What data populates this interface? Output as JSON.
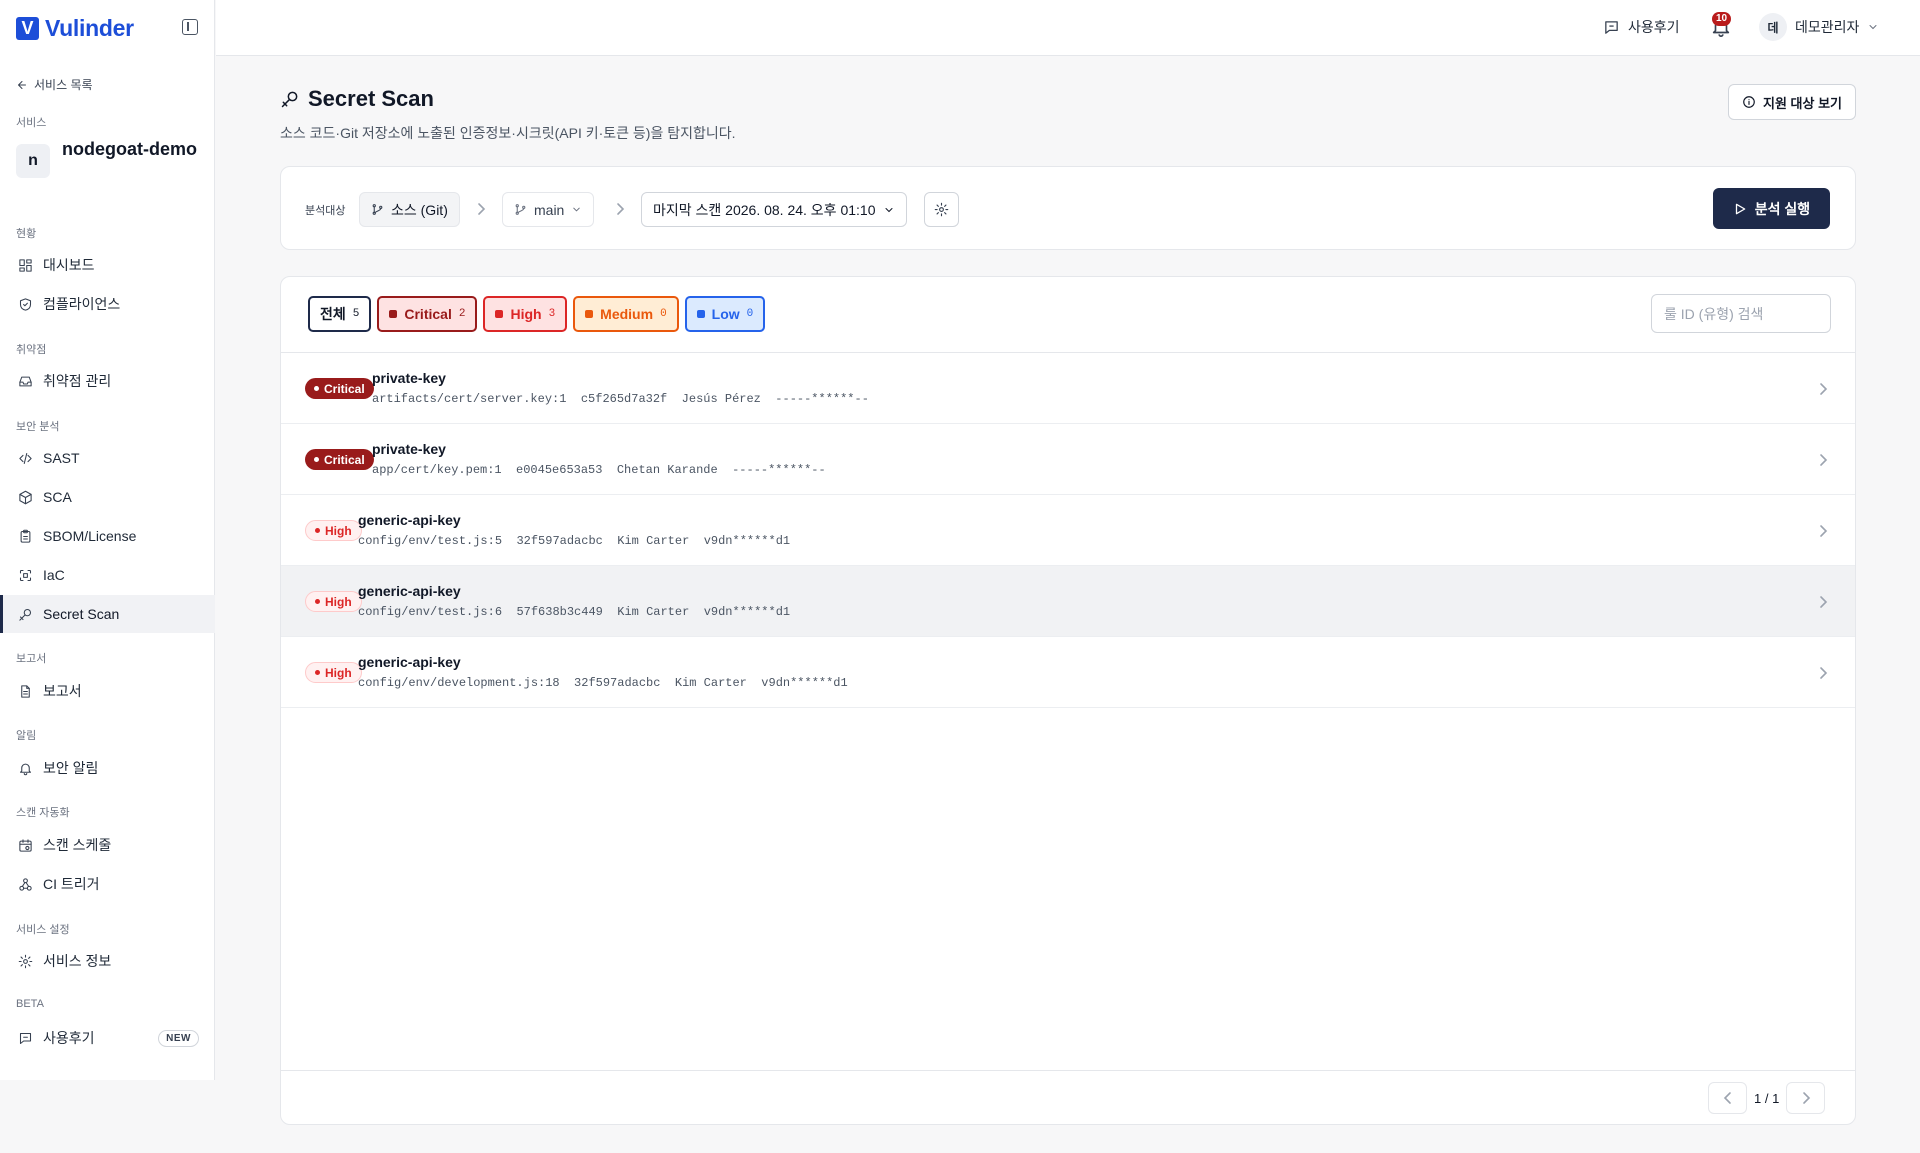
{
  "app": {
    "logo_letter": "V",
    "name": "Vulinder"
  },
  "sidebar": {
    "back_label": "서비스 목록",
    "service_section": "서비스",
    "service_avatar": "n",
    "service_name": "nodegoat-demo",
    "sections": {
      "status": "현황",
      "vuln": "취약점",
      "security": "보안 분석",
      "report": "보고서",
      "alert": "알림",
      "automation": "스캔 자동화",
      "settings": "서비스 설정",
      "beta": "BETA"
    },
    "items": {
      "dashboard": "대시보드",
      "compliance": "컴플라이언스",
      "vuln_mgmt": "취약점 관리",
      "sast": "SAST",
      "sca": "SCA",
      "sbom": "SBOM/License",
      "iac": "IaC",
      "secret": "Secret Scan",
      "reports": "보고서",
      "sec_alert": "보안 알림",
      "schedule": "스캔 스케줄",
      "ci": "CI 트리거",
      "svc_info": "서비스 정보",
      "review": "사용후기"
    },
    "new_badge": "NEW"
  },
  "header": {
    "review_label": "사용후기",
    "notif_count": "10",
    "user_avatar": "데",
    "user_name": "데모관리자"
  },
  "page": {
    "title": "Secret Scan",
    "subtitle": "소스 코드·Git 저장소에 노출된 인증정보·시크릿(API 키·토큰 등)을 탐지합니다.",
    "support_label": "지원 대상 보기"
  },
  "target": {
    "label": "분석대상",
    "source": "소스 (Git)",
    "branch": "main",
    "last_scan": "마지막 스캔 2026. 08. 24. 오후 01:10",
    "run_label": "분석 실행"
  },
  "filters": [
    {
      "label": "전체",
      "count": "5"
    },
    {
      "label": "Critical",
      "count": "2"
    },
    {
      "label": "High",
      "count": "3"
    },
    {
      "label": "Medium",
      "count": "0"
    },
    {
      "label": "Low",
      "count": "0"
    }
  ],
  "search": {
    "placeholder": "룰 ID (유형) 검색",
    "value": ""
  },
  "findings": [
    {
      "severity": "Critical",
      "rule": "private-key",
      "file": "artifacts/cert/server.key:1",
      "commit": "c5f265d7a32f",
      "author": "Jesús Pérez",
      "secret": "-----******--"
    },
    {
      "severity": "Critical",
      "rule": "private-key",
      "file": "app/cert/key.pem:1",
      "commit": "e0045e653a53",
      "author": "Chetan Karande",
      "secret": "-----******--"
    },
    {
      "severity": "High",
      "rule": "generic-api-key",
      "file": "config/env/test.js:5",
      "commit": "32f597adacbc",
      "author": "Kim Carter",
      "secret": "v9dn******d1"
    },
    {
      "severity": "High",
      "rule": "generic-api-key",
      "file": "config/env/test.js:6",
      "commit": "57f638b3c449",
      "author": "Kim Carter",
      "secret": "v9dn******d1"
    },
    {
      "severity": "High",
      "rule": "generic-api-key",
      "file": "config/env/development.js:18",
      "commit": "32f597adacbc",
      "author": "Kim Carter",
      "secret": "v9dn******d1"
    }
  ],
  "pagination": {
    "text": "1 / 1"
  },
  "colors": {
    "brand": "#1d4ed8",
    "primary": "#1e2a4a",
    "critical": "#991b1b",
    "high": "#dc2626",
    "medium": "#ea580c",
    "low": "#2563eb"
  },
  "icons": [
    "collapse-sidebar-icon",
    "arrow-left-icon",
    "grid-icon",
    "shield-icon",
    "inbox-icon",
    "code-icon",
    "package-icon",
    "clipboard-icon",
    "scan-icon",
    "key-icon",
    "file-icon",
    "bell-icon",
    "calendar-clock-icon",
    "webhook-icon",
    "gear-icon",
    "message-icon",
    "git-branch-icon",
    "chevron-right-icon",
    "chevron-down-icon",
    "info-icon",
    "play-icon",
    "chevron-left-icon"
  ]
}
